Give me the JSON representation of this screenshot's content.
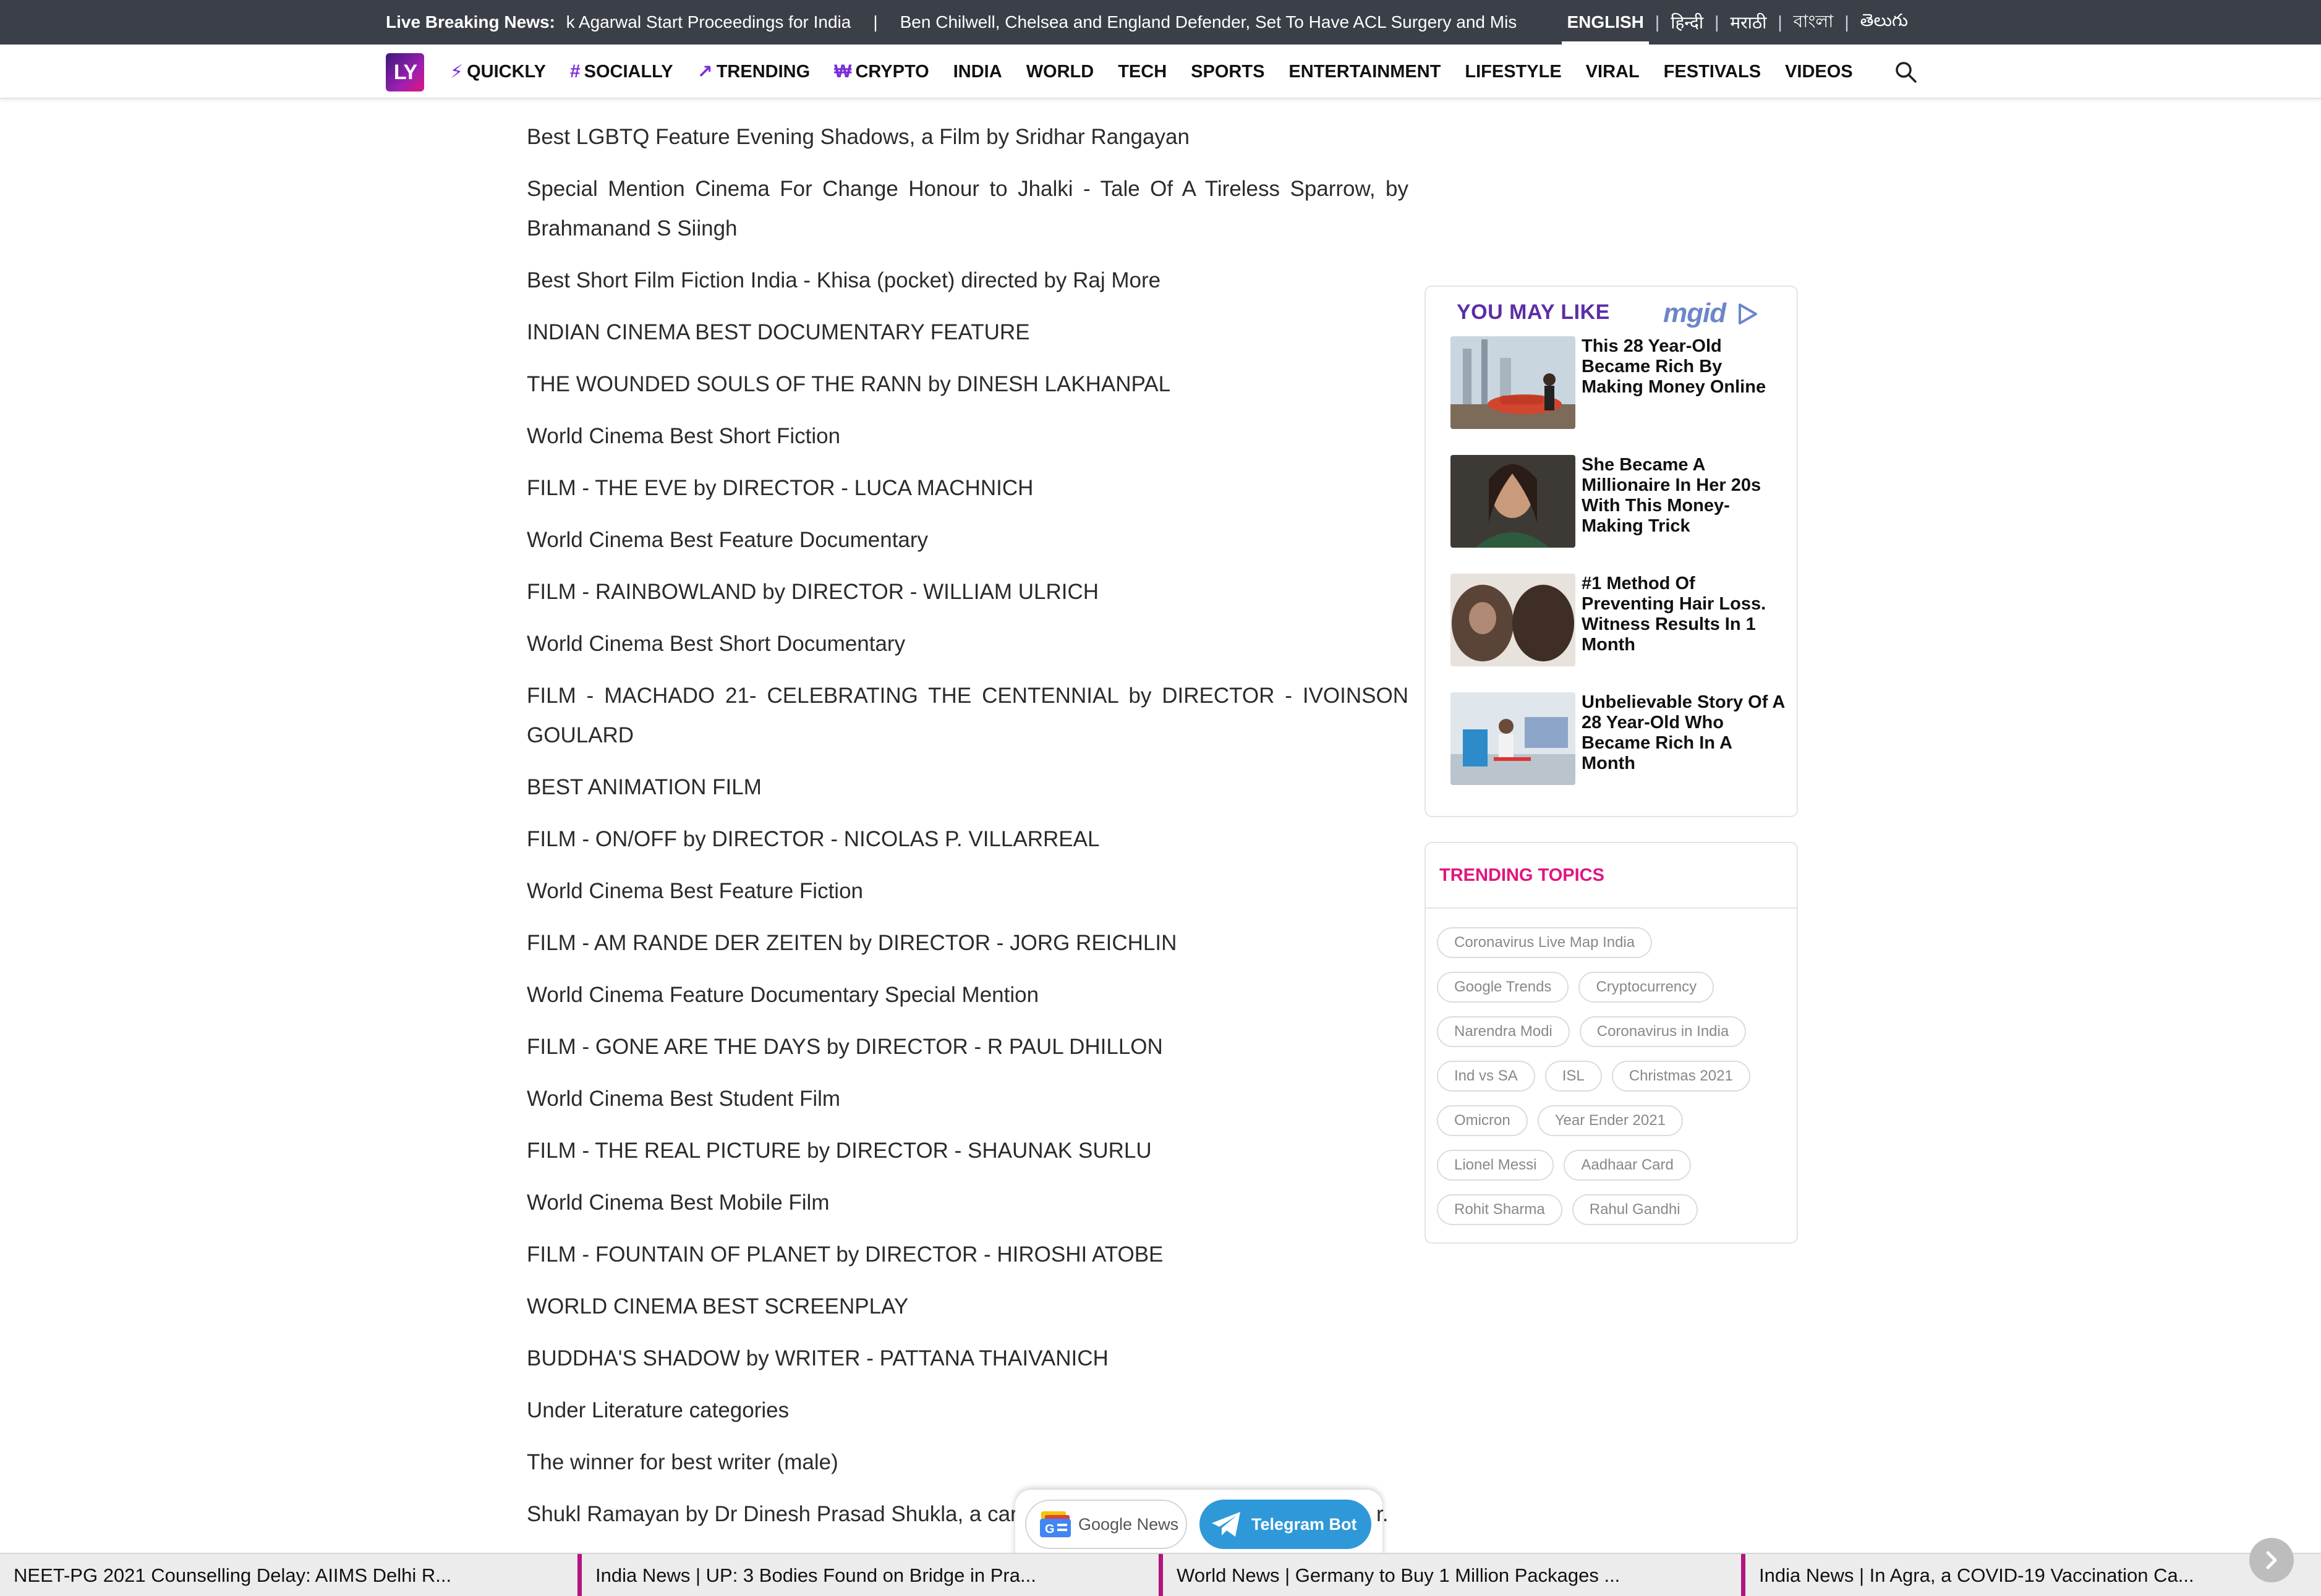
{
  "topbar": {
    "breaking_label": "Live Breaking News:",
    "ticker": [
      "ık Agarwal Start Proceedings for India",
      "|",
      "Ben Chilwell, Chelsea and England Defender, Set To Have ACL Surgery and Miss Res"
    ],
    "languages": [
      "ENGLISH",
      "हिन्दी",
      "मराठी",
      "বাংলা",
      "తెలుగు"
    ],
    "active_language": "ENGLISH"
  },
  "nav": {
    "logo_text": "LY",
    "items": [
      {
        "label": "QUICKLY",
        "icon": "lightning-icon",
        "glyph": "⚡"
      },
      {
        "label": "SOCIALLY",
        "icon": "hashtag-icon",
        "glyph": "#"
      },
      {
        "label": "TRENDING",
        "icon": "trending-arrow-icon",
        "glyph": "↗"
      },
      {
        "label": "CRYPTO",
        "icon": "crypto-icon",
        "glyph": "₩"
      },
      {
        "label": "INDIA"
      },
      {
        "label": "WORLD"
      },
      {
        "label": "TECH"
      },
      {
        "label": "SPORTS"
      },
      {
        "label": "ENTERTAINMENT"
      },
      {
        "label": "LIFESTYLE"
      },
      {
        "label": "VIRAL"
      },
      {
        "label": "FESTIVALS"
      },
      {
        "label": "VIDEOS"
      }
    ],
    "search_icon": "search-icon"
  },
  "article": {
    "paragraphs": [
      "Best LGBTQ Feature Evening Shadows, a Film by Sridhar Rangayan",
      "Special Mention Cinema For Change Honour to Jhalki - Tale Of A Tireless Sparrow, by Brahmanand S Siingh",
      "Best Short Film Fiction India - Khisa (pocket) directed by Raj More",
      "INDIAN CINEMA BEST DOCUMENTARY FEATURE",
      "THE WOUNDED SOULS OF THE RANN by DINESH LAKHANPAL",
      "World Cinema Best Short Fiction",
      "FILM - THE EVE by DIRECTOR - LUCA MACHNICH",
      "World Cinema Best Feature Documentary",
      "FILM - RAINBOWLAND by DIRECTOR - WILLIAM ULRICH",
      "World Cinema Best Short Documentary",
      "FILM - MACHADO 21- CELEBRATING THE CENTENNIAL by DIRECTOR - IVOINSON GOULARD",
      "BEST ANIMATION FILM",
      "FILM - ON/OFF by DIRECTOR - NICOLAS P. VILLARREAL",
      "World Cinema Best Feature Fiction",
      "FILM - AM RANDE DER ZEITEN by DIRECTOR - JORG REICHLIN",
      "World Cinema Feature Documentary Special Mention",
      "FILM - GONE ARE THE DAYS by DIRECTOR - R PAUL DHILLON",
      "World Cinema Best Student Film",
      "FILM - THE REAL PICTURE by DIRECTOR - SHAUNAK SURLU",
      "World Cinema Best Mobile Film",
      "FILM - FOUNTAIN OF PLANET by DIRECTOR - HIROSHI ATOBE",
      "WORLD CINEMA BEST SCREENPLAY",
      "BUDDHA'S SHADOW by WRITER - PATTANA THAIVANICH",
      "Under Literature categories",
      "The winner for best writer (male)",
      "Shukl Ramayan by Dr Dinesh Prasad Shukla, a car"
    ]
  },
  "you_may_like": {
    "title": "YOU MAY LIKE",
    "brand": "mgid",
    "items": [
      {
        "text": "This 28 Year-Old Became Rich By Making Money Online"
      },
      {
        "text": "She Became A Millionaire In Her 20s With This Money-Making Trick"
      },
      {
        "text": "#1 Method Of Preventing Hair Loss. Witness Results In 1 Month"
      },
      {
        "text": "Unbelievable Story Of A 28 Year-Old Who Became Rich In A Month"
      }
    ]
  },
  "trending_topics": {
    "title": "TRENDING TOPICS",
    "rows": [
      [
        "Coronavirus Live Map India"
      ],
      [
        "Google Trends",
        "Cryptocurrency"
      ],
      [
        "Narendra Modi",
        "Coronavirus in India"
      ],
      [
        "Ind vs SA",
        "ISL",
        "Christmas 2021"
      ],
      [
        "Omicron",
        "Year Ender 2021"
      ],
      [
        "Lionel Messi",
        "Aadhaar Card"
      ],
      [
        "Rohit Sharma",
        "Rahul Gandhi"
      ]
    ]
  },
  "share": {
    "google_news_label": "Google News",
    "telegram_label": "Telegram Bot",
    "trailing_text": "r."
  },
  "bottom_strip": {
    "items": [
      "NEET-PG 2021 Counselling Delay: AIIMS Delhi R...",
      "India News | UP: 3 Bodies Found on Bridge in Pra...",
      "World News | Germany to Buy 1 Million Packages ...",
      "India News | In Agra, a COVID-19 Vaccination Ca..."
    ]
  },
  "colors": {
    "topbar_bg": "#3b3f47",
    "accent_purple": "#5b2ea6",
    "accent_pink": "#e0157f",
    "telegram_blue": "#2f98d8"
  }
}
